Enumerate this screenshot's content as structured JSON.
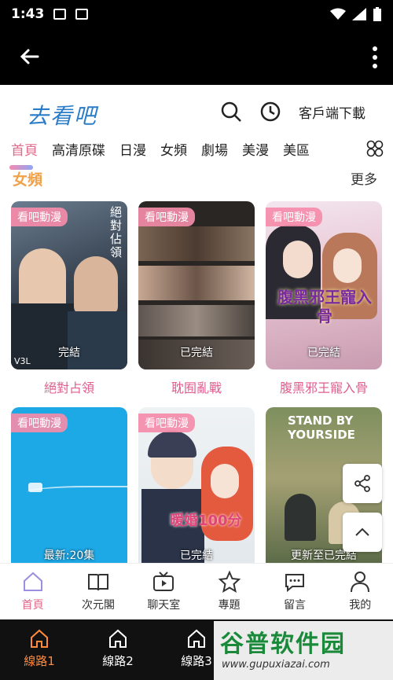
{
  "status_bar": {
    "time": "1:43"
  },
  "site": {
    "logo_text": "去看吧",
    "client_download": "客戶端下載"
  },
  "nav": {
    "items": [
      "首頁",
      "高清原碟",
      "日漫",
      "女頻",
      "劇場",
      "美漫",
      "美區"
    ]
  },
  "section": {
    "title": "女頻",
    "more": "更多"
  },
  "cards": [
    {
      "badge": "看吧動漫",
      "status": "完結",
      "title": "絕對占領"
    },
    {
      "badge": "看吧動漫",
      "status": "已完結",
      "title": "耽囿亂戰"
    },
    {
      "badge": "看吧動漫",
      "status": "已完結",
      "title": "腹黑邪王寵入骨"
    },
    {
      "badge": "看吧動漫",
      "status": "最新:20集",
      "title": ""
    },
    {
      "badge": "看吧動漫",
      "status": "已完結",
      "title": ""
    },
    {
      "badge": "",
      "status": "更新至已完結",
      "title": ""
    }
  ],
  "card_art_text": {
    "c1_side": "絕對佔領",
    "c1_corner": "V3L",
    "c3_art": "腹黑邪王寵入骨",
    "c5_art": "暖婚100分",
    "c6_art": "STAND BY YOURSIDE"
  },
  "tabs": [
    {
      "label": "首頁",
      "icon": "home-icon"
    },
    {
      "label": "次元閣",
      "icon": "book-icon"
    },
    {
      "label": "聊天室",
      "icon": "tv-icon"
    },
    {
      "label": "專題",
      "icon": "star-icon"
    },
    {
      "label": "留言",
      "icon": "chat-icon"
    },
    {
      "label": "我的",
      "icon": "user-icon"
    }
  ],
  "routes": [
    {
      "label": "線路1"
    },
    {
      "label": "線路2"
    },
    {
      "label": "線路3"
    }
  ],
  "watermark": {
    "main": "谷普软件园",
    "url": "www.gupuxiazai.com"
  },
  "colors": {
    "accent_pink": "#e05d8e",
    "accent_orange": "#ff8a3d",
    "logo_blue": "#2a7cc7"
  }
}
